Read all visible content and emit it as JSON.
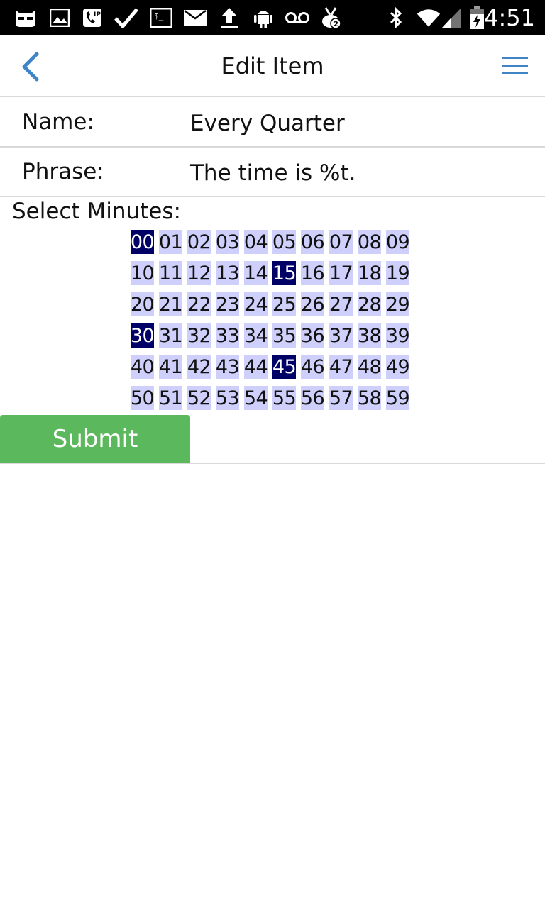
{
  "status_bar": {
    "time": "4:51",
    "notification_icons": [
      "cyanogen-mod-icon",
      "image-icon",
      "voip-call-icon",
      "checkmark-icon",
      "terminal-icon",
      "email-icon",
      "upload-icon",
      "android-icon",
      "voicemail-icon",
      "tv-notification-icon"
    ],
    "notification_badge": "2",
    "system_icons": [
      "bluetooth-icon",
      "wifi-icon",
      "signal-icon",
      "battery-charging-icon"
    ]
  },
  "header": {
    "title": "Edit Item",
    "back_icon": "chevron-left-icon",
    "menu_icon": "hamburger-menu-icon",
    "accent_color": "#3f84c7"
  },
  "form": {
    "name_label": "Name:",
    "name_value": "Every Quarter",
    "phrase_label": "Phrase:",
    "phrase_value": "The time is %t.",
    "minutes_label": "Select Minutes:",
    "minutes": [
      "00",
      "01",
      "02",
      "03",
      "04",
      "05",
      "06",
      "07",
      "08",
      "09",
      "10",
      "11",
      "12",
      "13",
      "14",
      "15",
      "16",
      "17",
      "18",
      "19",
      "20",
      "21",
      "22",
      "23",
      "24",
      "25",
      "26",
      "27",
      "28",
      "29",
      "30",
      "31",
      "32",
      "33",
      "34",
      "35",
      "36",
      "37",
      "38",
      "39",
      "40",
      "41",
      "42",
      "43",
      "44",
      "45",
      "46",
      "47",
      "48",
      "49",
      "50",
      "51",
      "52",
      "53",
      "54",
      "55",
      "56",
      "57",
      "58",
      "59"
    ],
    "selected_minutes": [
      "00",
      "15",
      "30",
      "45"
    ],
    "minute_color": "#cfcffb",
    "selected_minute_color": "#000066",
    "submit_label": "Submit",
    "submit_color": "#5cb85c"
  }
}
